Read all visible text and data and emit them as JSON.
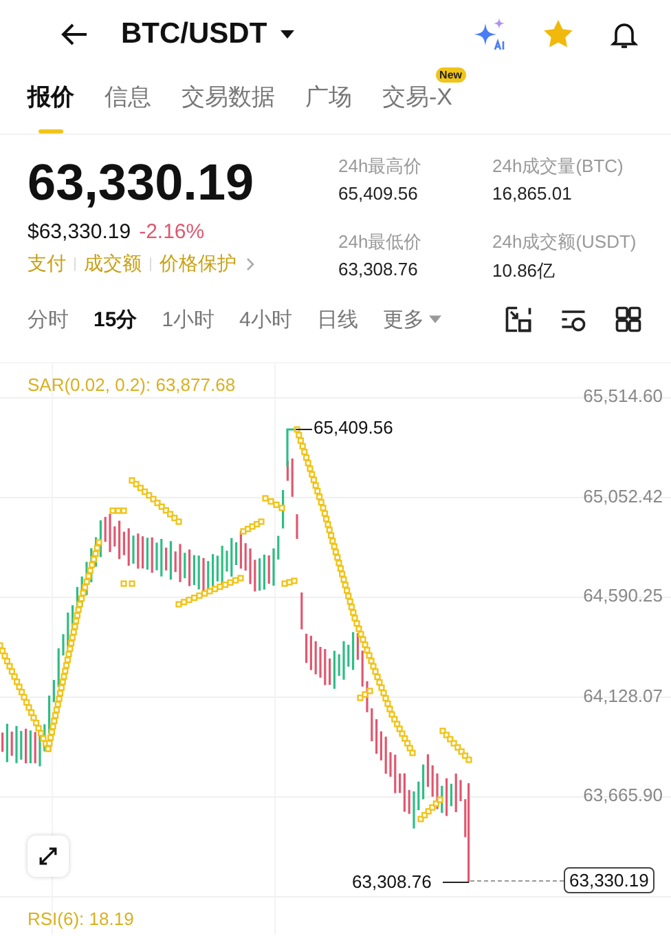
{
  "header": {
    "title": "BTC/USDT"
  },
  "tabs": [
    {
      "label": "报价",
      "selected": true
    },
    {
      "label": "信息",
      "selected": false
    },
    {
      "label": "交易数据",
      "selected": false
    },
    {
      "label": "广场",
      "selected": false
    },
    {
      "label": "交易-X",
      "selected": false,
      "badge": "New"
    }
  ],
  "price": {
    "last": "63,330.19",
    "usd": "$63,330.19",
    "change": "-2.16%"
  },
  "links": [
    "支付",
    "成交额",
    "价格保护"
  ],
  "stats": [
    {
      "label": "24h最高价",
      "value": "65,409.56"
    },
    {
      "label": "24h成交量(BTC)",
      "value": "16,865.01"
    },
    {
      "label": "24h最低价",
      "value": "63,308.76"
    },
    {
      "label": "24h成交额(USDT)",
      "value": "10.86亿"
    }
  ],
  "intervals": [
    {
      "label": "分时",
      "selected": false
    },
    {
      "label": "15分",
      "selected": true
    },
    {
      "label": "1小时",
      "selected": false
    },
    {
      "label": "4小时",
      "selected": false
    },
    {
      "label": "日线",
      "selected": false
    },
    {
      "label": "更多",
      "selected": false,
      "kind": "dropdown"
    }
  ],
  "chart": {
    "indicator": "SAR(0.02, 0.2): 63,877.68",
    "y_ticks": [
      "65,514.60",
      "65,052.42",
      "64,590.25",
      "64,128.07",
      "63,665.90"
    ],
    "high_label": "65,409.56",
    "low_label": "63,308.76",
    "last_price": "63,330.19",
    "rsi": "RSI(6): 18.19"
  }
}
